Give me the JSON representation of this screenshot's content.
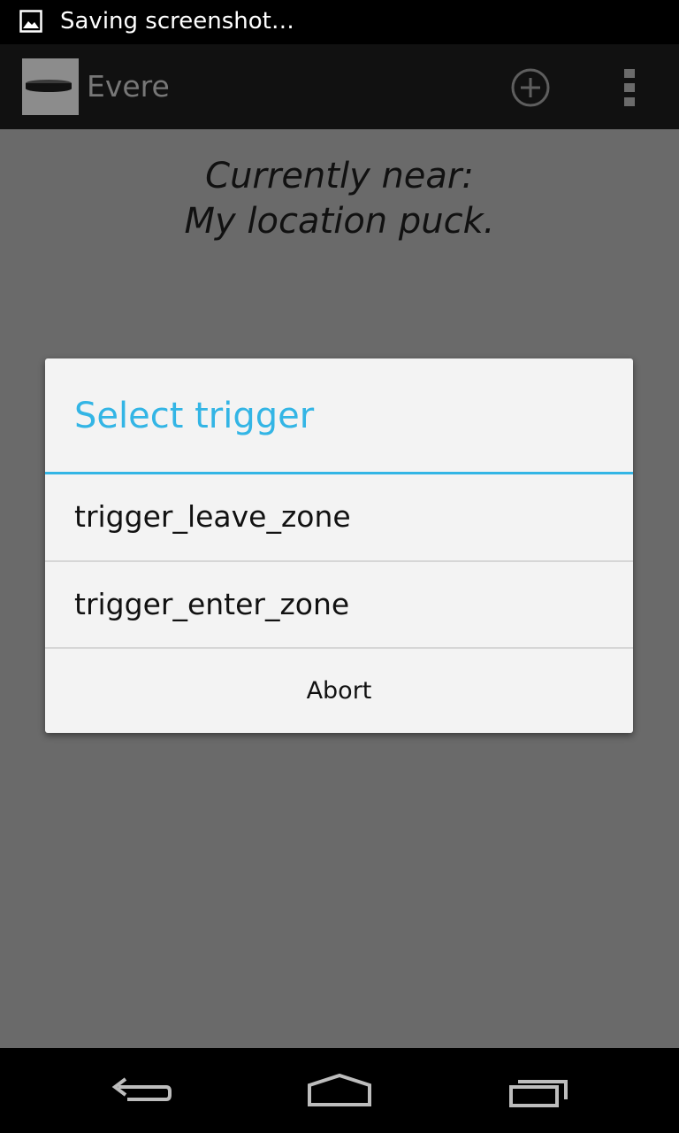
{
  "status_bar": {
    "notification_icon": "image-icon",
    "text": "Saving screenshot…"
  },
  "action_bar": {
    "logo_icon": "puck-icon",
    "title": "Evere",
    "add_icon": "add-circle-icon",
    "overflow_icon": "overflow-menu-icon"
  },
  "content": {
    "near_label": "Currently near:",
    "near_value": "My location puck."
  },
  "dialog": {
    "title": "Select trigger",
    "options": [
      {
        "label": "trigger_leave_zone"
      },
      {
        "label": "trigger_enter_zone"
      }
    ],
    "abort_label": "Abort",
    "accent_color": "#33b5e5"
  },
  "nav_bar": {
    "back_icon": "back-icon",
    "home_icon": "home-icon",
    "recents_icon": "recents-icon"
  }
}
